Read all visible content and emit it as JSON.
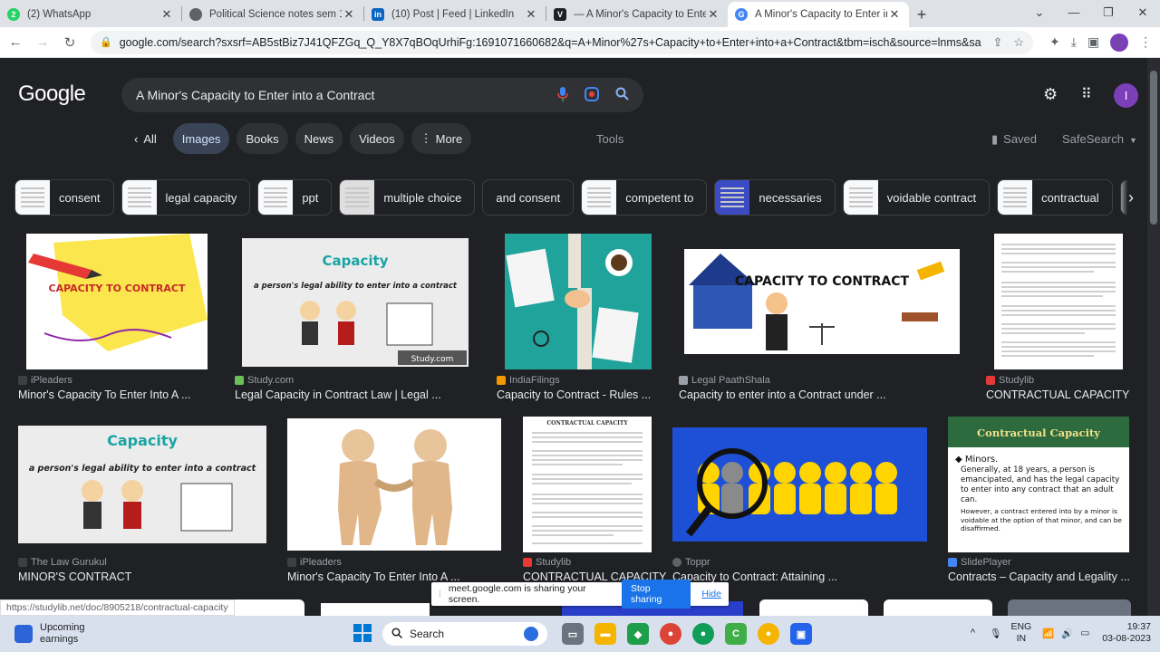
{
  "tabs": [
    {
      "title": "(2) WhatsApp",
      "icon": "whatsapp-icon",
      "color": "#25d366",
      "glyph": "2"
    },
    {
      "title": "Political Science notes sem 1 (1).p",
      "icon": "globe-icon",
      "color": "#5f6368",
      "glyph": ""
    },
    {
      "title": "(10) Post | Feed | LinkedIn",
      "icon": "linkedin-icon",
      "color": "#0a66c2",
      "glyph": "in"
    },
    {
      "title": "— A Minor's Capacity to Enter in",
      "icon": "v-icon",
      "color": "#202124",
      "glyph": "V"
    },
    {
      "title": "A Minor's Capacity to Enter into a",
      "icon": "google-icon",
      "color": "#4285f4",
      "glyph": "G"
    }
  ],
  "url": "google.com/search?sxsrf=AB5stBiz7J41QFZGq_Q_Y8X7qBOqUrhiFg:1691071660682&q=A+Minor%27s+Capacity+to+Enter+into+a+Contract&tbm=isch&source=lnms&sa=X&ved=2ah...",
  "search": {
    "logo": "Google",
    "query": "A Minor's Capacity to Enter into a Contract"
  },
  "filters": {
    "all": "All",
    "images": "Images",
    "books": "Books",
    "news": "News",
    "videos": "Videos",
    "more": "More",
    "tools": "Tools",
    "saved": "Saved",
    "safesearch": "SafeSearch"
  },
  "suggestions": [
    "consent",
    "legal capacity",
    "ppt",
    "multiple choice",
    "and consent",
    "competent to",
    "necessaries",
    "voidable contract",
    "contractual"
  ],
  "results": [
    {
      "source": "iPleaders",
      "title": "Minor's Capacity To Enter Into A ...",
      "img_text": "CAPACITY TO CONTRACT"
    },
    {
      "source": "Study.com",
      "title": "Legal Capacity in Contract Law | Legal ...",
      "img_text": "Capacity",
      "img_sub": "a person's legal ability to enter into a contract",
      "img_badge": "Study.com"
    },
    {
      "source": "IndiaFilings",
      "title": "Capacity to Contract - Rules ..."
    },
    {
      "source": "Legal PaathShala",
      "title": "Capacity to enter into a Contract under ...",
      "img_text": "CAPACITY TO CONTRACT"
    },
    {
      "source": "Studylib",
      "title": "CONTRACTUAL CAPACITY"
    },
    {
      "source": "The Law Gurukul",
      "title": "MINOR'S CONTRACT",
      "img_text": "Capacity",
      "img_sub": "a person's legal ability to enter into a contract"
    },
    {
      "source": "iPleaders",
      "title": "Minor's Capacity To Enter Into A ..."
    },
    {
      "source": "Studylib",
      "title": "CONTRACTUAL CAPACITY",
      "img_text": "CONTRACTUAL CAPACITY"
    },
    {
      "source": "Toppr",
      "title": "Capacity to Contract: Attaining ..."
    },
    {
      "source": "SlidePlayer",
      "title": "Contracts – Capacity and Legality ...",
      "img_text": "Contractual Capacity",
      "img_b1": "Minors.",
      "img_b2": "Generally, at 18 years, a person is emancipated, and has the legal capacity to enter into any contract that an adult can.",
      "img_b3": "However, a contract entered into by a minor is voidable at the option of that minor, and can be disaffirmed."
    }
  ],
  "share_banner": {
    "text": "meet.google.com is sharing your screen.",
    "stop": "Stop sharing",
    "hide": "Hide"
  },
  "status_url": "https://studylib.net/doc/8905218/contractual-capacity",
  "taskbar": {
    "weather_title": "Upcoming",
    "weather_sub": "earnings",
    "search": "Search",
    "lang1": "ENG",
    "lang2": "IN",
    "time": "19:37",
    "date": "03-08-2023"
  }
}
